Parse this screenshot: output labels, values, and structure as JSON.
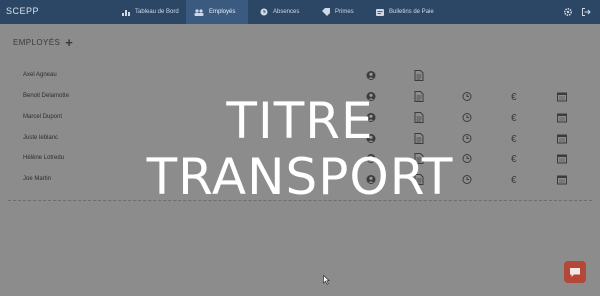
{
  "app": {
    "brand": "SCEPP"
  },
  "nav": {
    "items": [
      {
        "label": "Tableau de Bord",
        "icon": "chart-icon"
      },
      {
        "label": "Employés",
        "icon": "users-icon",
        "active": true
      },
      {
        "label": "Absences",
        "icon": "clock-icon"
      },
      {
        "label": "Primes",
        "icon": "tag-icon"
      },
      {
        "label": "Bulletins de Paie",
        "icon": "document-icon"
      }
    ]
  },
  "page": {
    "title": "EMPLOYÉS"
  },
  "employees": [
    {
      "name": "Axel Agneau"
    },
    {
      "name": "Benoit Delamotte"
    },
    {
      "name": "Marcel Dupont"
    },
    {
      "name": "Juste leblanc"
    },
    {
      "name": "Hélène Lotredu"
    },
    {
      "name": "Joe Martin"
    }
  ],
  "overlay": {
    "line1": "TITRE",
    "line2": "TRANSPORT"
  },
  "colors": {
    "topbar": "#2c4766",
    "active_tab": "#3a5a80",
    "chat": "#b44838"
  }
}
